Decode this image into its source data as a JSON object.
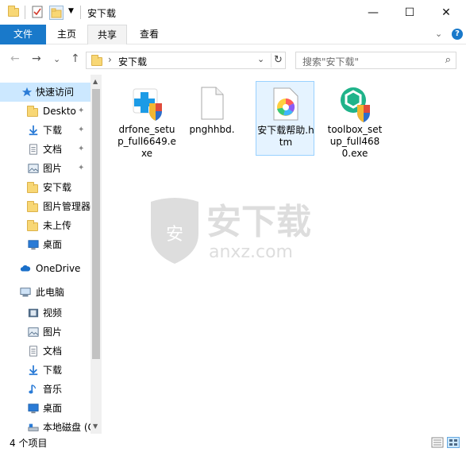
{
  "window": {
    "title": "安下载",
    "minimize": "—",
    "maximize": "☐",
    "close": "✕"
  },
  "ribbon": {
    "tabs": [
      {
        "label": "文件"
      },
      {
        "label": "主页"
      },
      {
        "label": "共享"
      },
      {
        "label": "查看"
      }
    ],
    "collapse": "⌄",
    "help": "?"
  },
  "nav": {
    "back": "←",
    "forward": "→",
    "recent": "⌄",
    "up": "↑",
    "breadcrumb_sep": "›",
    "address": "安下载",
    "address_drop": "⌄",
    "refresh": "↻",
    "search_placeholder": "搜索\"安下载\"",
    "search_icon": "⌕"
  },
  "sidebar": {
    "items": [
      {
        "label": "快速访问",
        "icon": "star-icon",
        "level": 0
      },
      {
        "label": "Deskto",
        "icon": "folder-icon",
        "level": 1,
        "pinned": true
      },
      {
        "label": "下载",
        "icon": "download-icon",
        "level": 1,
        "pinned": true
      },
      {
        "label": "文档",
        "icon": "document-icon",
        "level": 1,
        "pinned": true
      },
      {
        "label": "图片",
        "icon": "picture-icon",
        "level": 1,
        "pinned": true
      },
      {
        "label": "安下载",
        "icon": "folder-icon",
        "level": 1
      },
      {
        "label": "图片管理器",
        "icon": "folder-icon",
        "level": 1
      },
      {
        "label": "未上传",
        "icon": "folder-icon",
        "level": 1
      },
      {
        "label": "桌面",
        "icon": "desktop-icon",
        "level": 1
      },
      {
        "label": "OneDrive",
        "icon": "cloud-icon",
        "level": 0
      },
      {
        "label": "此电脑",
        "icon": "computer-icon",
        "level": 0
      },
      {
        "label": "视频",
        "icon": "video-icon",
        "level": 1
      },
      {
        "label": "图片",
        "icon": "picture-icon",
        "level": 1
      },
      {
        "label": "文档",
        "icon": "document-icon",
        "level": 1
      },
      {
        "label": "下载",
        "icon": "download-icon",
        "level": 1
      },
      {
        "label": "音乐",
        "icon": "music-icon",
        "level": 1
      },
      {
        "label": "桌面",
        "icon": "desktop-icon",
        "level": 1
      },
      {
        "label": "本地磁盘 (C",
        "icon": "disk-icon",
        "level": 1
      }
    ],
    "pin_glyph": "📌"
  },
  "files": [
    {
      "name": "drfone_setup_full6649.exe",
      "icon": "drfone-installer-icon"
    },
    {
      "name": "pnghhbd.",
      "icon": "blank-file-icon"
    },
    {
      "name": "安下载帮助.htm",
      "icon": "html-file-icon"
    },
    {
      "name": "toolbox_setup_full4680.exe",
      "icon": "toolbox-installer-icon"
    }
  ],
  "watermark": {
    "main": "安下载",
    "sub": "anxz.com",
    "shield": "安"
  },
  "status": {
    "count": "4 个项目"
  },
  "colors": {
    "accent": "#1979ca",
    "selection": "#cce8ff",
    "folder": "#f8d775"
  }
}
